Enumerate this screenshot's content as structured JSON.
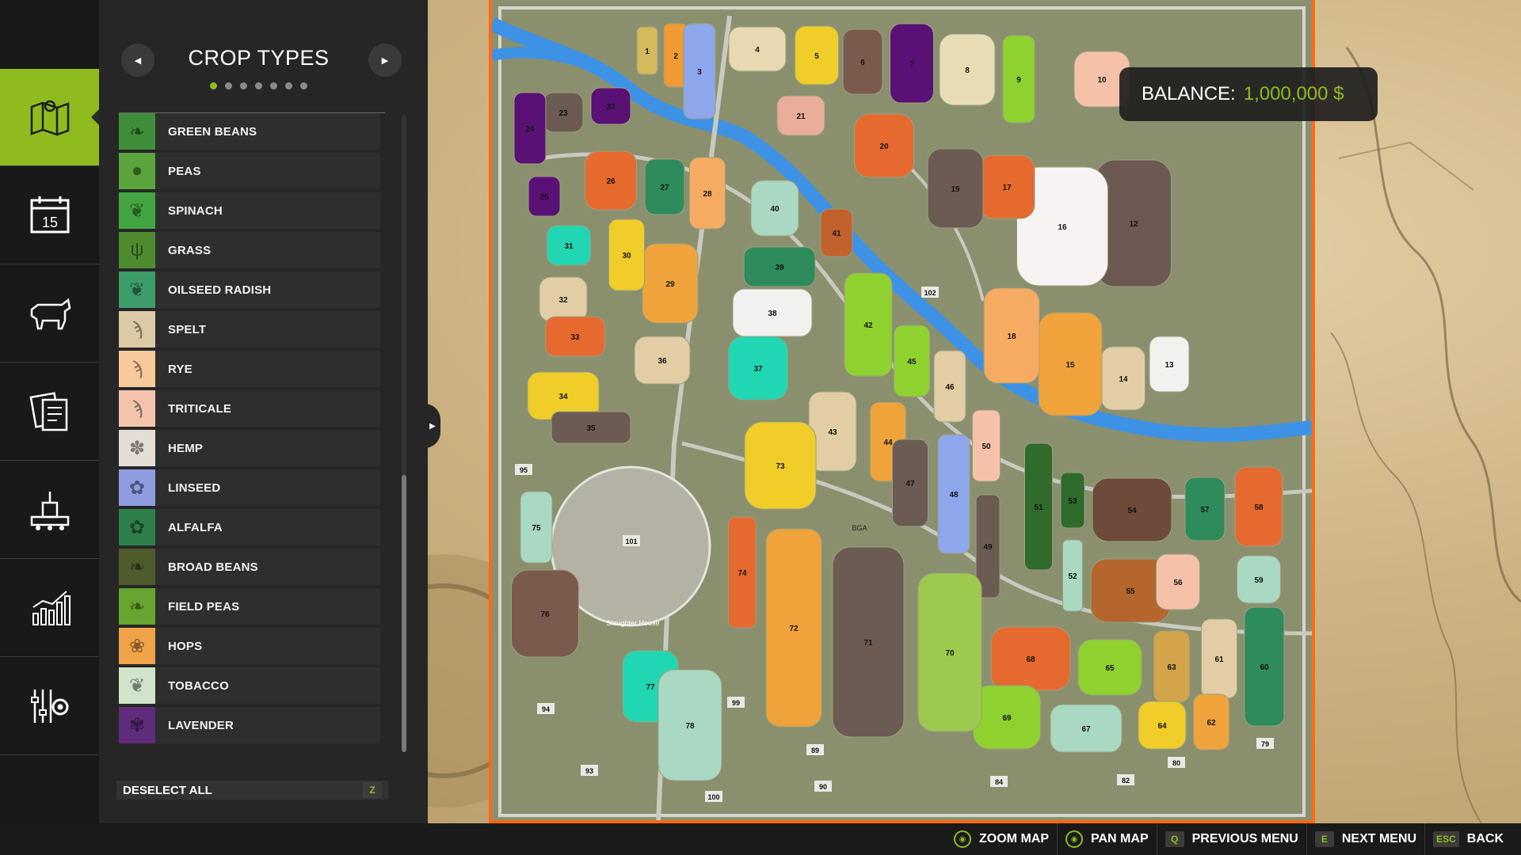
{
  "panel": {
    "title": "CROP TYPES",
    "prev_icon": "triangle-left-icon",
    "next_icon": "triangle-right-icon",
    "page_count": 7,
    "current_page": 1,
    "deselect_label": "DESELECT ALL",
    "deselect_key": "Z",
    "crops": [
      {
        "label": "GREEN BEANS",
        "color": "#3f8f3a",
        "icon": "green-beans-icon"
      },
      {
        "label": "PEAS",
        "color": "#5aa43b",
        "icon": "peas-icon"
      },
      {
        "label": "SPINACH",
        "color": "#43a542",
        "icon": "spinach-icon"
      },
      {
        "label": "GRASS",
        "color": "#4e8b2f",
        "icon": "grass-icon"
      },
      {
        "label": "OILSEED RADISH",
        "color": "#3c9c6a",
        "icon": "oilseed-radish-icon"
      },
      {
        "label": "SPELT",
        "color": "#dcc9a5",
        "icon": "spelt-icon"
      },
      {
        "label": "RYE",
        "color": "#f7c99b",
        "icon": "rye-icon"
      },
      {
        "label": "TRITICALE",
        "color": "#f3c4ab",
        "icon": "triticale-icon"
      },
      {
        "label": "HEMP",
        "color": "#e3ddd5",
        "icon": "hemp-icon"
      },
      {
        "label": "LINSEED",
        "color": "#8f9de0",
        "icon": "linseed-icon"
      },
      {
        "label": "ALFALFA",
        "color": "#2f7f4b",
        "icon": "alfalfa-icon"
      },
      {
        "label": "BROAD BEANS",
        "color": "#4f5b2a",
        "icon": "broad-beans-icon"
      },
      {
        "label": "FIELD PEAS",
        "color": "#66a52f",
        "icon": "field-peas-icon"
      },
      {
        "label": "HOPS",
        "color": "#f0a349",
        "icon": "hops-icon"
      },
      {
        "label": "TOBACCO",
        "color": "#cfe4cb",
        "icon": "tobacco-icon"
      },
      {
        "label": "LAVENDER",
        "color": "#5e2c7a",
        "icon": "lavender-icon"
      }
    ]
  },
  "nav": [
    {
      "name": "map",
      "icon": "map-icon",
      "active": true
    },
    {
      "name": "calendar",
      "icon": "calendar-icon",
      "active": false,
      "day": "15"
    },
    {
      "name": "animals",
      "icon": "cow-icon",
      "active": false
    },
    {
      "name": "contracts",
      "icon": "contracts-icon",
      "active": false
    },
    {
      "name": "production",
      "icon": "factory-icon",
      "active": false
    },
    {
      "name": "statistics",
      "icon": "statistics-icon",
      "active": false
    },
    {
      "name": "settings",
      "icon": "settings-gear-icon",
      "active": false
    }
  ],
  "balance": {
    "label": "BALANCE:",
    "value": "1,000,000 $"
  },
  "map": {
    "map_labels": [
      "Slaughter House",
      "BGA"
    ],
    "fields": [
      {
        "id": "1",
        "color": "#d4b95d"
      },
      {
        "id": "2",
        "color": "#f09a33"
      },
      {
        "id": "3",
        "color": "#8ea6ec"
      },
      {
        "id": "4",
        "color": "#e8d9b0"
      },
      {
        "id": "5",
        "color": "#f0cd28"
      },
      {
        "id": "6",
        "color": "#7b5a4e"
      },
      {
        "id": "7",
        "color": "#5a1175"
      },
      {
        "id": "8",
        "color": "#e8dcb5"
      },
      {
        "id": "9",
        "color": "#8fd230"
      },
      {
        "id": "10",
        "color": "#f6c1a9"
      },
      {
        "id": "12",
        "color": "#6c5a52"
      },
      {
        "id": "13",
        "color": "#f3f0f0"
      },
      {
        "id": "14",
        "color": "#e2cda4"
      },
      {
        "id": "15",
        "color": "#f0a33b"
      },
      {
        "id": "16",
        "color": "#f7f3f2"
      },
      {
        "id": "17",
        "color": "#e66a2e"
      },
      {
        "id": "18",
        "color": "#f6ab62"
      },
      {
        "id": "19",
        "color": "#6b5b52"
      },
      {
        "id": "20",
        "color": "#e6692f"
      },
      {
        "id": "21",
        "color": "#e9ad9a"
      },
      {
        "id": "22",
        "color": "#5a1175"
      },
      {
        "id": "23",
        "color": "#6b5b52"
      },
      {
        "id": "24",
        "color": "#5a1175"
      },
      {
        "id": "25",
        "color": "#5a1175"
      },
      {
        "id": "26",
        "color": "#e66a2e"
      },
      {
        "id": "27",
        "color": "#2e8b5c"
      },
      {
        "id": "28",
        "color": "#f6ab62"
      },
      {
        "id": "29",
        "color": "#f0a33b"
      },
      {
        "id": "30",
        "color": "#f0cd28"
      },
      {
        "id": "31",
        "color": "#21d7b3"
      },
      {
        "id": "32",
        "color": "#e2cda4"
      },
      {
        "id": "33",
        "color": "#e6692f"
      },
      {
        "id": "34",
        "color": "#f0cd28"
      },
      {
        "id": "35",
        "color": "#6b5b52"
      },
      {
        "id": "36",
        "color": "#e2cda4"
      },
      {
        "id": "37",
        "color": "#21d7b3"
      },
      {
        "id": "38",
        "color": "#f3f0f0"
      },
      {
        "id": "39",
        "color": "#2e8b5c"
      },
      {
        "id": "40",
        "color": "#a9d8c3"
      },
      {
        "id": "41",
        "color": "#c1622d"
      },
      {
        "id": "42",
        "color": "#8fd230"
      },
      {
        "id": "43",
        "color": "#e2cda4"
      },
      {
        "id": "44",
        "color": "#f0a33b"
      },
      {
        "id": "45",
        "color": "#8fd230"
      },
      {
        "id": "46",
        "color": "#e2cda4"
      },
      {
        "id": "47",
        "color": "#6b5b52"
      },
      {
        "id": "48",
        "color": "#8ea6ec"
      },
      {
        "id": "49",
        "color": "#6b5b52"
      },
      {
        "id": "50",
        "color": "#f6c1a9"
      },
      {
        "id": "51",
        "color": "#2f6b2a"
      },
      {
        "id": "52",
        "color": "#a9d8c3"
      },
      {
        "id": "53",
        "color": "#2f6b2a"
      },
      {
        "id": "54",
        "color": "#6e4a3a"
      },
      {
        "id": "55",
        "color": "#b5662d"
      },
      {
        "id": "56",
        "color": "#f6c1a9"
      },
      {
        "id": "57",
        "color": "#2e8b5c"
      },
      {
        "id": "58",
        "color": "#e6692f"
      },
      {
        "id": "59",
        "color": "#a9d8c3"
      },
      {
        "id": "60",
        "color": "#2e8b5c"
      },
      {
        "id": "61",
        "color": "#e2cda4"
      },
      {
        "id": "62",
        "color": "#f0a33b"
      },
      {
        "id": "63",
        "color": "#d4a44a"
      },
      {
        "id": "64",
        "color": "#f0cd28"
      },
      {
        "id": "65",
        "color": "#8fd230"
      },
      {
        "id": "67",
        "color": "#a9d8c3"
      },
      {
        "id": "68",
        "color": "#e6692f"
      },
      {
        "id": "69",
        "color": "#8fd230"
      },
      {
        "id": "70",
        "color": "#9ec94f"
      },
      {
        "id": "71",
        "color": "#6b5b52"
      },
      {
        "id": "72",
        "color": "#f0a33b"
      },
      {
        "id": "73",
        "color": "#f0cd28"
      },
      {
        "id": "74",
        "color": "#e6692f"
      },
      {
        "id": "75",
        "color": "#a9d8c3"
      },
      {
        "id": "76",
        "color": "#7b5a4e"
      },
      {
        "id": "77",
        "color": "#21d7b3"
      },
      {
        "id": "78",
        "color": "#a9d8c3"
      }
    ],
    "markers": [
      "79",
      "80",
      "82",
      "84",
      "89",
      "90",
      "93",
      "94",
      "95",
      "99",
      "100",
      "101",
      "102"
    ]
  },
  "bottom_hints": [
    {
      "icon": "gamepad-stick-icon",
      "key": "",
      "label": "ZOOM MAP"
    },
    {
      "icon": "gamepad-stick-icon",
      "key": "",
      "label": "PAN MAP"
    },
    {
      "icon": "",
      "key": "Q",
      "label": "PREVIOUS MENU"
    },
    {
      "icon": "",
      "key": "E",
      "label": "NEXT MENU"
    },
    {
      "icon": "",
      "key": "ESC",
      "label": "BACK"
    }
  ]
}
